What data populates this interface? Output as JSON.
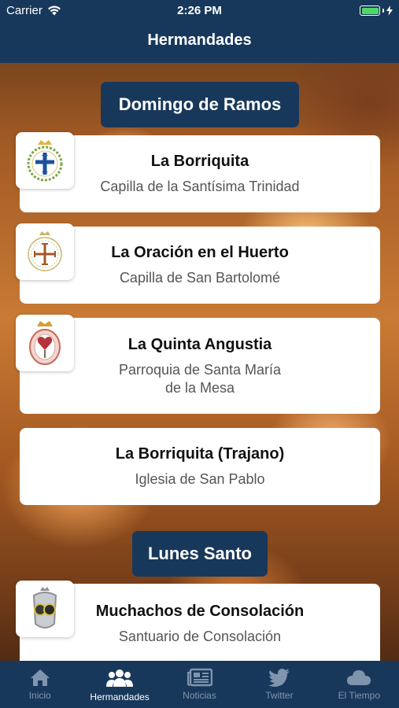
{
  "status_bar": {
    "carrier": "Carrier",
    "time": "2:26 PM"
  },
  "nav": {
    "title": "Hermandades"
  },
  "sections": [
    {
      "title": "Domingo de Ramos",
      "items": [
        {
          "name": "La Borriquita",
          "church": "Capilla de la Santísima Trinidad",
          "logo": "cross-emblem-blue"
        },
        {
          "name": "La Oración en el Huerto",
          "church": "Capilla de San Bartolomé",
          "logo": "jerusalem-cross-emblem"
        },
        {
          "name": "La Quinta Angustia",
          "church": "Parroquia de Santa María de la Mesa",
          "logo": "heart-crown-emblem"
        },
        {
          "name": "La Borriquita (Trajano)",
          "church": "Iglesia de San Pablo",
          "logo": ""
        }
      ]
    },
    {
      "title": "Lunes Santo",
      "items": [
        {
          "name": "Muchachos de Consolación",
          "church": "Santuario de Consolación",
          "logo": "consolacion-emblem"
        }
      ]
    }
  ],
  "tabbar": {
    "tabs": [
      {
        "label": "Inicio",
        "icon": "home-icon",
        "active": false
      },
      {
        "label": "Hermandades",
        "icon": "group-icon",
        "active": true
      },
      {
        "label": "Noticias",
        "icon": "newspaper-icon",
        "active": false
      },
      {
        "label": "Twitter",
        "icon": "twitter-bird-icon",
        "active": false
      },
      {
        "label": "El Tiempo",
        "icon": "cloud-icon",
        "active": false
      }
    ]
  },
  "colors": {
    "navy": "#18385b",
    "tab_inactive": "#7f95ad",
    "battery_green": "#4cd964"
  }
}
